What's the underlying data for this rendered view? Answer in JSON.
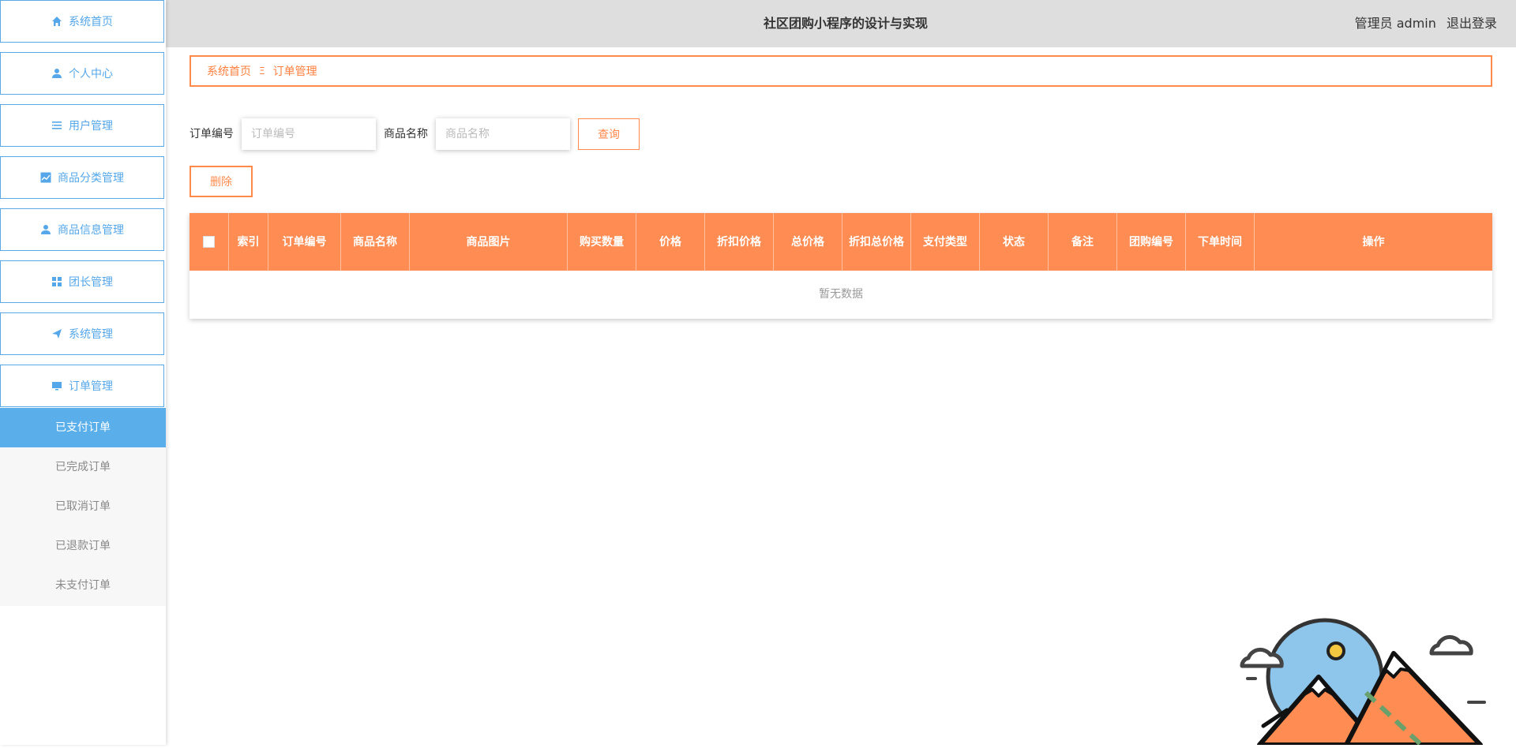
{
  "app_title": "社区团购小程序的设计与实现",
  "user": {
    "role_name": "管理员 admin",
    "logout": "退出登录"
  },
  "sidebar": {
    "items": [
      {
        "label": "系统首页",
        "icon": "home-icon"
      },
      {
        "label": "个人中心",
        "icon": "user-icon"
      },
      {
        "label": "用户管理",
        "icon": "list-icon"
      },
      {
        "label": "商品分类管理",
        "icon": "chart-icon"
      },
      {
        "label": "商品信息管理",
        "icon": "user-icon"
      },
      {
        "label": "团长管理",
        "icon": "grid-icon"
      },
      {
        "label": "系统管理",
        "icon": "send-icon"
      },
      {
        "label": "订单管理",
        "icon": "monitor-icon"
      }
    ],
    "submenu": [
      {
        "label": "已支付订单",
        "active": true
      },
      {
        "label": "已完成订单",
        "active": false
      },
      {
        "label": "已取消订单",
        "active": false
      },
      {
        "label": "已退款订单",
        "active": false
      },
      {
        "label": "未支付订单",
        "active": false
      }
    ]
  },
  "breadcrumb": {
    "home": "系统首页",
    "separator": "Ξ",
    "current": "订单管理"
  },
  "search": {
    "order_no_label": "订单编号",
    "order_no_placeholder": "订单编号",
    "order_no_value": "",
    "product_name_label": "商品名称",
    "product_name_placeholder": "商品名称",
    "product_name_value": "",
    "query_button": "查询"
  },
  "actions": {
    "delete_button": "删除"
  },
  "table": {
    "columns": [
      "索引",
      "订单编号",
      "商品名称",
      "商品图片",
      "购买数量",
      "价格",
      "折扣价格",
      "总价格",
      "折扣总价格",
      "支付类型",
      "状态",
      "备注",
      "团购编号",
      "下单时间",
      "操作"
    ],
    "rows": [],
    "empty_text": "暂无数据"
  },
  "colors": {
    "accent": "#ff8c52",
    "sidebar_text": "#55a7e9",
    "active_submenu": "#5aafeb"
  }
}
